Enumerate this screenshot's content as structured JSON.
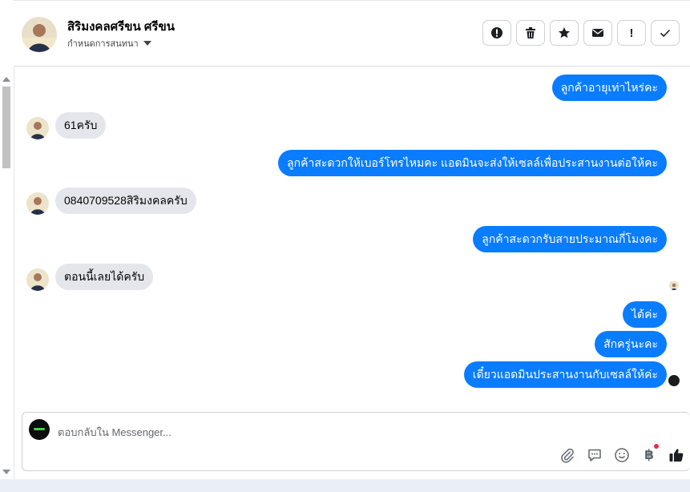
{
  "header": {
    "contact_name": "สิริมงคลศรีขน ศรีขน",
    "subtitle": "กำหนดการสนทนา",
    "actions": [
      {
        "name": "report-icon",
        "label": ""
      },
      {
        "name": "trash-icon",
        "label": ""
      },
      {
        "name": "star-icon",
        "label": ""
      },
      {
        "name": "mail-icon",
        "label": ""
      },
      {
        "name": "exclamation-icon",
        "label": "!"
      },
      {
        "name": "check-icon",
        "label": ""
      }
    ]
  },
  "messages": [
    {
      "side": "out",
      "text": "ลูกค้าอายุเท่าไหร่คะ"
    },
    {
      "side": "in",
      "text": "61ครับ"
    },
    {
      "side": "out",
      "text": "ลูกค้าสะดวกให้เบอร์โทรไหมคะ แอดมินจะส่งให้เซลล์เพื่อประสานงานต่อให้คะ"
    },
    {
      "side": "in",
      "text": "0840709528สิริมงคลครับ"
    },
    {
      "side": "out",
      "text": "ลูกค้าสะดวกรับสายประมาณกี่โมงคะ"
    },
    {
      "side": "in",
      "text": "ตอนนี้เลยได้ครับ"
    },
    {
      "side": "out",
      "text": "ได้ค่ะ"
    },
    {
      "side": "out",
      "text": "สักครู่นะคะ"
    },
    {
      "side": "out",
      "text": "เดี๋ยวแอดมินประสานงานกับเซลล์ให้ค่ะ"
    }
  ],
  "composer": {
    "placeholder": "ตอบกลับใน Messenger...",
    "baht_symbol": "฿"
  },
  "colors": {
    "outgoing_bubble": "#0a7cff",
    "incoming_bubble": "#e4e6eb",
    "like": "#1c1e21"
  }
}
